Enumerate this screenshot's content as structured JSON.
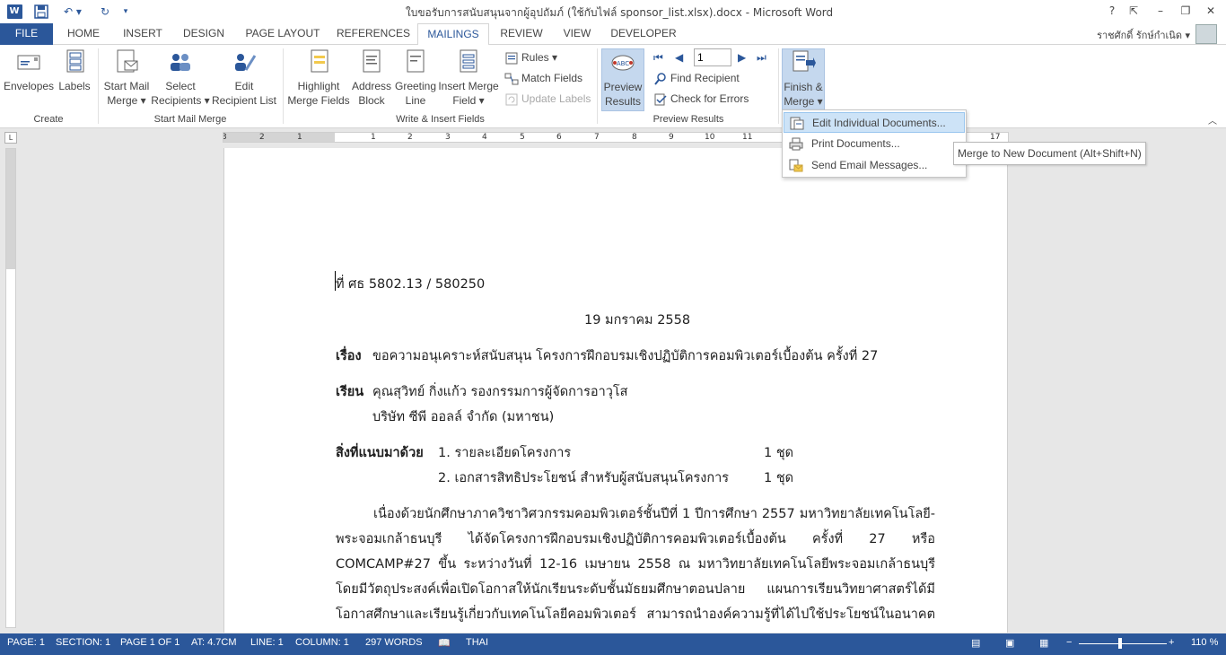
{
  "titlebar": {
    "app_icon": "W",
    "title": "ใบขอรับการสนับสนุนจากผู้อุปถัมภ์ (ใช้กับไฟล์ sponsor_list.xlsx).docx - Microsoft Word",
    "help": "?",
    "minimize": "–",
    "restore": "❐",
    "close": "✕",
    "ribbon_options": "⇱"
  },
  "quick_access": {
    "save_icon": "💾",
    "undo_icon": "↶ ▾",
    "redo_icon": "↻",
    "customize_icon": "▾"
  },
  "tabs": [
    "FILE",
    "HOME",
    "INSERT",
    "DESIGN",
    "PAGE LAYOUT",
    "REFERENCES",
    "MAILINGS",
    "REVIEW",
    "VIEW",
    "DEVELOPER"
  ],
  "user": {
    "name": "ราชศักดิ์ รักษ์กำเนิด ▾"
  },
  "ribbon": {
    "create": {
      "label": "Create",
      "envelopes": "Envelopes",
      "labels": "Labels"
    },
    "start": {
      "label": "Start Mail Merge",
      "start_mail_merge": [
        "Start Mail",
        "Merge ▾"
      ],
      "select_recipients": [
        "Select",
        "Recipients ▾"
      ],
      "edit_recipient_list": [
        "Edit",
        "Recipient List"
      ]
    },
    "write": {
      "label": "Write & Insert Fields",
      "highlight": [
        "Highlight",
        "Merge Fields"
      ],
      "address_block": [
        "Address",
        "Block"
      ],
      "greeting_line": [
        "Greeting",
        "Line"
      ],
      "insert_merge_field": [
        "Insert Merge",
        "Field ▾"
      ],
      "rules": "Rules ▾",
      "match_fields": "Match Fields",
      "update_labels": "Update Labels"
    },
    "preview": {
      "label": "Preview Results",
      "preview_results": [
        "Preview",
        "Results"
      ],
      "record_value": "1",
      "find_recipient": "Find Recipient",
      "check_errors": "Check for Errors"
    },
    "finish": {
      "finish_merge": [
        "Finish &",
        "Merge ▾"
      ]
    },
    "collapse": "︿"
  },
  "finish_menu": {
    "items": [
      "Edit Individual Documents...",
      "Print Documents...",
      "Send Email Messages..."
    ],
    "tooltip": "Merge to New Document (Alt+Shift+N)"
  },
  "ruler": {
    "ticks": [
      "3",
      "2",
      "1",
      "1",
      "2",
      "3",
      "4",
      "5",
      "6",
      "7",
      "8",
      "9",
      "10",
      "11",
      "17"
    ]
  },
  "document": {
    "ref": "ที่ ศธ 5802.13 / 580250",
    "date": "19 มกราคม 2558",
    "subject_label": "เรื่อง",
    "subject": "ขอความอนุเคราะห์สนับสนุน โครงการฝึกอบรมเชิงปฏิบัติการคอมพิวเตอร์เบื้องต้น ครั้งที่ 27",
    "to_label": "เรียน",
    "to_name": "คุณสุวิทย์ กิ่งแก้ว รองกรรมการผู้จัดการอาวุโส",
    "to_company": "บริษัท ซีพี ออลล์ จำกัด (มหาชน)",
    "enclosure_label": "สิ่งที่แนบมาด้วย",
    "enclosures": [
      {
        "item": "1. รายละเอียดโครงการ",
        "qty": "1 ชุด"
      },
      {
        "item": "2. เอกสารสิทธิประโยชน์ สำหรับผู้สนับสนุนโครงการ",
        "qty": "1 ชุด"
      }
    ],
    "body_lines": [
      "เนื่องด้วยนักศึกษาภาควิชาวิศวกรรมคอมพิวเตอร์ชั้นปีที่ 1 ปีการศึกษา 2557 มหาวิทยาลัยเทคโนโลยี-",
      "พระจอมเกล้าธนบุรี ได้จัดโครงการฝึกอบรมเชิงปฏิบัติการคอมพิวเตอร์เบื้องต้น ครั้งที่ 27 หรือ",
      "COMCAMP#27 ขึ้น ระหว่างวันที่ 12-16 เมษายน 2558 ณ มหาวิทยาลัยเทคโนโลยีพระจอมเกล้าธนบุรี",
      "โดยมีวัตถุประสงค์เพื่อเปิดโอกาสให้นักเรียนระดับชั้นมัธยมศึกษาตอนปลาย แผนการเรียนวิทยาศาสตร์ได้มี",
      "โอกาสศึกษาและเรียนรู้เกี่ยวกับเทคโนโลยีคอมพิวเตอร์ สามารถนำองค์ความรู้ที่ได้ไปใช้ประโยชน์ในอนาคต"
    ]
  },
  "status": {
    "page": "PAGE: 1",
    "section": "SECTION: 1",
    "page_of": "PAGE 1 OF 1",
    "at": "AT: 4.7CM",
    "line": "LINE: 1",
    "column": "COLUMN: 1",
    "words": "297 WORDS",
    "proof_icon": "📖",
    "language": "THAI",
    "zoom": "110 %",
    "zoom_fraction": 0.47
  },
  "colors": {
    "accent": "#2b579a",
    "menu_highlight": "#cde3f7",
    "pressed": "#c5d8ee"
  }
}
